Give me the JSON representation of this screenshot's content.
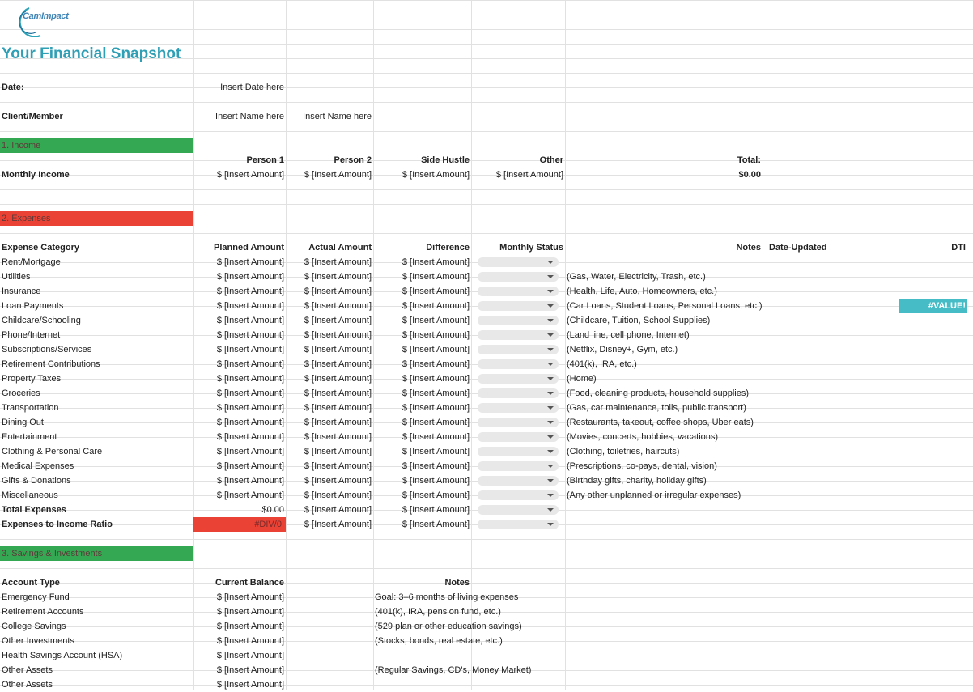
{
  "brand": {
    "logo_text": "CamImpact",
    "accent": "#2f9fb5",
    "green": "#34a853",
    "red": "#ea4335",
    "teal": "#46bdc6"
  },
  "title": "Your Financial Snapshot",
  "date": {
    "label": "Date:",
    "value": "Insert Date here"
  },
  "client": {
    "label": "Client/Member",
    "name1": "Insert Name here",
    "name2": "Insert Name here"
  },
  "income": {
    "section": "1. Income",
    "headers": [
      "Person 1",
      "Person 2",
      "Side Hustle",
      "Other"
    ],
    "total_label": "Total:",
    "row_label": "Monthly Income",
    "values": [
      "$ [Insert Amount]",
      "$ [Insert Amount]",
      "$ [Insert Amount]",
      "$ [Insert Amount]"
    ],
    "total_value": "$0.00"
  },
  "expenses": {
    "section": "2. Expenses",
    "headers": {
      "category": "Expense Category",
      "planned": "Planned Amount",
      "actual": "Actual Amount",
      "difference": "Difference",
      "status": "Monthly Status",
      "notes": "Notes",
      "updated": "Date-Updated",
      "dti": "DTI"
    },
    "placeholder": "$ [Insert Amount]",
    "dti_value": "#VALUE!",
    "rows": [
      {
        "name": "Rent/Mortgage",
        "note": ""
      },
      {
        "name": "Utilities",
        "note": "(Gas, Water, Electricity, Trash, etc.)"
      },
      {
        "name": "Insurance",
        "note": "(Health, Life, Auto, Homeowners, etc.)"
      },
      {
        "name": "Loan Payments",
        "note": "(Car Loans, Student Loans, Personal Loans, etc.)"
      },
      {
        "name": "Childcare/Schooling",
        "note": "(Childcare, Tuition, School Supplies)"
      },
      {
        "name": "Phone/Internet",
        "note": "(Land line, cell phone, Internet)"
      },
      {
        "name": "Subscriptions/Services",
        "note": "(Netflix, Disney+, Gym, etc.)"
      },
      {
        "name": "Retirement Contributions",
        "note": "(401(k), IRA, etc.)"
      },
      {
        "name": "Property Taxes",
        "note": "(Home)"
      },
      {
        "name": "Groceries",
        "note": "(Food, cleaning products, household supplies)"
      },
      {
        "name": "Transportation",
        "note": "(Gas, car maintenance, tolls, public transport)"
      },
      {
        "name": "Dining Out",
        "note": "(Restaurants, takeout, coffee shops, Uber eats)"
      },
      {
        "name": "Entertainment",
        "note": "(Movies, concerts, hobbies, vacations)"
      },
      {
        "name": "Clothing & Personal Care",
        "note": "(Clothing, toiletries, haircuts)"
      },
      {
        "name": "Medical Expenses",
        "note": "(Prescriptions, co-pays, dental, vision)"
      },
      {
        "name": "Gifts & Donations",
        "note": "(Birthday gifts, charity, holiday gifts)"
      },
      {
        "name": "Miscellaneous",
        "note": "(Any other unplanned or irregular expenses)"
      }
    ],
    "total": {
      "label": "Total Expenses",
      "planned": "$0.00"
    },
    "ratio": {
      "label": "Expenses to Income Ratio",
      "planned": "#DIV/0!"
    }
  },
  "savings": {
    "section": "3. Savings & Investments",
    "headers": {
      "type": "Account Type",
      "balance": "Current Balance",
      "notes": "Notes"
    },
    "placeholder": "$ [Insert Amount]",
    "rows": [
      {
        "name": "Emergency Fund",
        "note": "Goal: 3–6 months of living expenses"
      },
      {
        "name": "Retirement Accounts",
        "note": "(401(k), IRA, pension fund, etc.)"
      },
      {
        "name": "College Savings",
        "note": "(529 plan or other education savings)"
      },
      {
        "name": "Other Investments",
        "note": "(Stocks, bonds, real estate, etc.)"
      },
      {
        "name": "Health Savings Account (HSA)",
        "note": ""
      },
      {
        "name": "Other Assets",
        "note": "(Regular Savings, CD's, Money Market)"
      },
      {
        "name": "Other Assets",
        "note": ""
      }
    ]
  }
}
